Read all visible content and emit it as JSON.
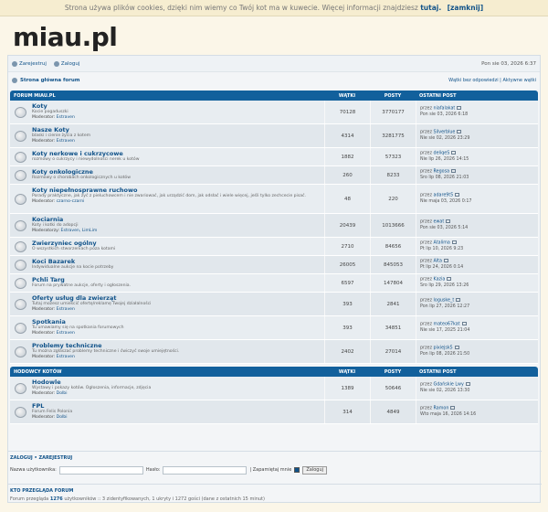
{
  "cookie": {
    "text": "Strona używa plików cookies, dzięki nim wiemy co Twój kot ma w kuwecie. Więcej informacji znajdziesz",
    "link": "tutaj.",
    "close": "[zamknij]"
  },
  "logo": "miau.pl",
  "topnav": {
    "register": "Zarejestruj",
    "login": "Zaloguj",
    "date": "Pon sie 03, 2026 6:37"
  },
  "crumbs": {
    "home": "Strona główna forum",
    "right": "Wątki bez odpowiedzi | Aktywne wątki"
  },
  "headers": [
    {
      "name": "FORUM MIAU.PL",
      "topics": "WĄTKI",
      "posts": "POSTY",
      "last": "OSTATNI POST"
    },
    {
      "name": "HODOWCY KOTÓW",
      "topics": "WĄTKI",
      "posts": "POSTY",
      "last": "OSTATNI POST"
    }
  ],
  "forums": [
    {
      "title": "Koty",
      "desc": "Kocie pogaduszki",
      "mod_label": "Moderator:",
      "mod": "Estraven",
      "topics": "70128",
      "posts": "3770177",
      "by": "przez",
      "user": "niafalakat",
      "date": "Pon sie 03, 2026 6:18"
    },
    {
      "title": "Nasze Koty",
      "desc": "blaski i cienie życia z kotem",
      "mod_label": "Moderator:",
      "mod": "Estraven",
      "topics": "4314",
      "posts": "3281775",
      "by": "przez",
      "user": "Silverblue",
      "date": "Nie sie 02, 2026 23:29"
    },
    {
      "title": "Koty nerkowe i cukrzycowe",
      "desc": "rozmowy o cukrzycy i niewydolności nerek u kotów",
      "mod_label": "",
      "mod": "",
      "topics": "1882",
      "posts": "57323",
      "by": "przez",
      "user": "deliqeS",
      "date": "Nie lip 26, 2026 14:15"
    },
    {
      "title": "Koty onkologiczne",
      "desc": "Rozmowy o chorobach onkologicznych u kotów",
      "mod_label": "",
      "mod": "",
      "topics": "260",
      "posts": "8233",
      "by": "przez",
      "user": "Regosa",
      "date": "Sro lip 08, 2026 21:03"
    },
    {
      "title": "Koty niepełnosprawne ruchowo",
      "desc": "Porady praktyczne, jak żyć z pieluchowcem i nie zwariować, jak urządzić dom, jak odsłać i wiele więcej, jeśli tylko zechcecie pisać.",
      "mod_label": "Moderator:",
      "mod": "czarno-czarni",
      "topics": "48",
      "posts": "220",
      "by": "przez",
      "user": "adare9t5",
      "date": "Nie maja 03, 2026 0:17"
    },
    {
      "title": "Kociarnia",
      "desc": "Koty i kotki do adopcji",
      "mod_label": "Moderatorzy:",
      "mod": "Estraven, LimLim",
      "topics": "20439",
      "posts": "1013666",
      "by": "przez",
      "user": "ewat",
      "date": "Pon sie 03, 2026 5:14"
    },
    {
      "title": "Zwierzyniec ogólny",
      "desc": "O wszystkich stworzeniach poza kotami",
      "mod_label": "",
      "mod": "",
      "topics": "2710",
      "posts": "84656",
      "by": "przez",
      "user": "Atalima",
      "date": "Pt lip 10, 2026 9:23"
    },
    {
      "title": "Koci Bazarek",
      "desc": "Indywidualne aukcje na kocie potrzeby",
      "mod_label": "",
      "mod": "",
      "topics": "26005",
      "posts": "845053",
      "by": "przez",
      "user": "Alta",
      "date": "Pt lip 24, 2026 0:14"
    },
    {
      "title": "Pchli Targ",
      "desc": "Forum na prywatne aukcje, oferty i ogłoszenia.",
      "mod_label": "",
      "mod": "",
      "topics": "6597",
      "posts": "147804",
      "by": "przez",
      "user": "Kazia",
      "date": "Sro lip 29, 2026 13:26"
    },
    {
      "title": "Oferty usług dla zwierząt",
      "desc": "Tutaj możesz umieścić ofertę/reklamę Twojej działalności",
      "mod_label": "Moderator:",
      "mod": "Estraven",
      "topics": "393",
      "posts": "2841",
      "by": "przez",
      "user": "loguske_t",
      "date": "Pon lip 27, 2026 12:27"
    },
    {
      "title": "Spotkania",
      "desc": "Tu umawiamy się na spotkania forumowych",
      "mod_label": "Moderator:",
      "mod": "Estraven",
      "topics": "393",
      "posts": "34851",
      "by": "przez",
      "user": "mateo67kat",
      "date": "Nie sie 17, 2025 21:04"
    },
    {
      "title": "Problemy techniczne",
      "desc": "Tu można zgłaszać problemy techniczne i ćwiczyć swoje umiejętności.",
      "mod_label": "Moderator:",
      "mod": "Estraven",
      "topics": "2402",
      "posts": "27014",
      "by": "przez",
      "user": "pixiejsk5",
      "date": "Pon lip 08, 2026 21:50"
    }
  ],
  "forums2": [
    {
      "title": "Hodowle",
      "desc": "Wystawy i pokazy kotów. Ogłoszenia, informacje, zdjęcia",
      "mod_label": "Moderator:",
      "mod": "Dolbi",
      "topics": "1389",
      "posts": "50646",
      "by": "przez",
      "user": "Gdańskie Lwy",
      "date": "Nie sie 02, 2026 13:30"
    },
    {
      "title": "FPL",
      "desc": "Forum Felis Polonia",
      "mod_label": "Moderator:",
      "mod": "Dolbi",
      "topics": "314",
      "posts": "4849",
      "by": "przez",
      "user": "Ramon",
      "date": "Wto maja 16, 2026 14:16"
    }
  ],
  "login": {
    "links": "ZALOGUJ • ZAREJESTRUJ",
    "user_label": "Nazwa użytkownika:",
    "pass_label": "Hasło:",
    "remember": "| Zapamiętaj mnie",
    "button": "Zaloguj"
  },
  "who": {
    "title": "KTO PRZEGLĄDA FORUM",
    "text_a": "Forum przegląda",
    "count": "1276",
    "text_b": "użytkowników :: 3 zidentyfikowanych, 1 ukryty i 1272 gości (dane z ostatnich 15 minut)"
  }
}
